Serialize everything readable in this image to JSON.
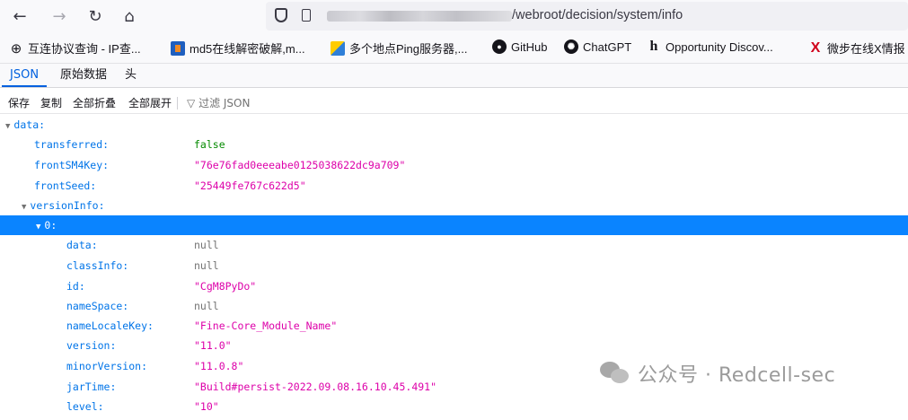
{
  "browser": {
    "url_suffix": "/webroot/decision/system/info"
  },
  "bookmarks": [
    {
      "label": "互连协议查询 - IP查...",
      "icon": "globe-icon",
      "color": "#3a3944"
    },
    {
      "label": "md5在线解密破解,m...",
      "icon": "md5-site-icon",
      "color": "#1f5fbf"
    },
    {
      "label": "多个地点Ping服务器,...",
      "icon": "ping-site-icon",
      "color": "#2f7fd8"
    },
    {
      "label": "GitHub",
      "icon": "github-icon",
      "color": "#15141a"
    },
    {
      "label": "ChatGPT",
      "icon": "chatgpt-icon",
      "color": "#15141a"
    },
    {
      "label": "Opportunity Discov...",
      "icon": "opportunity-icon",
      "color": "#15141a"
    },
    {
      "label": "微步在线X情报",
      "icon": "threatbook-icon",
      "color": "#d0021b"
    }
  ],
  "tabs": [
    "JSON",
    "原始数据",
    "头"
  ],
  "toolbar": {
    "save": "保存",
    "copy": "复制",
    "collapse_all": "全部折叠",
    "expand_all": "全部展开",
    "filter_placeholder": "过滤 JSON"
  },
  "tree": {
    "root": "data:",
    "transferred": {
      "key": "transferred:",
      "value": "false"
    },
    "frontSM4Key": {
      "key": "frontSM4Key:",
      "value": "\"76e76fad0eeeabe0125038622dc9a709\""
    },
    "frontSeed": {
      "key": "frontSeed:",
      "value": "\"25449fe767c622d5\""
    },
    "versionInfo": "versionInfo:",
    "item0": "0:",
    "fields": [
      {
        "key": "data:",
        "value": "null",
        "type": "null"
      },
      {
        "key": "classInfo:",
        "value": "null",
        "type": "null"
      },
      {
        "key": "id:",
        "value": "\"CgM8PyDo\"",
        "type": "str"
      },
      {
        "key": "nameSpace:",
        "value": "null",
        "type": "null"
      },
      {
        "key": "nameLocaleKey:",
        "value": "\"Fine-Core_Module_Name\"",
        "type": "str"
      },
      {
        "key": "version:",
        "value": "\"11.0\"",
        "type": "str"
      },
      {
        "key": "minorVersion:",
        "value": "\"11.0.8\"",
        "type": "str"
      },
      {
        "key": "jarTime:",
        "value": "\"Build#persist-2022.09.08.16.10.45.491\"",
        "type": "str"
      },
      {
        "key": "level:",
        "value": "\"10\"",
        "type": "str"
      }
    ]
  },
  "watermark": "公众号 · Redcell-sec"
}
